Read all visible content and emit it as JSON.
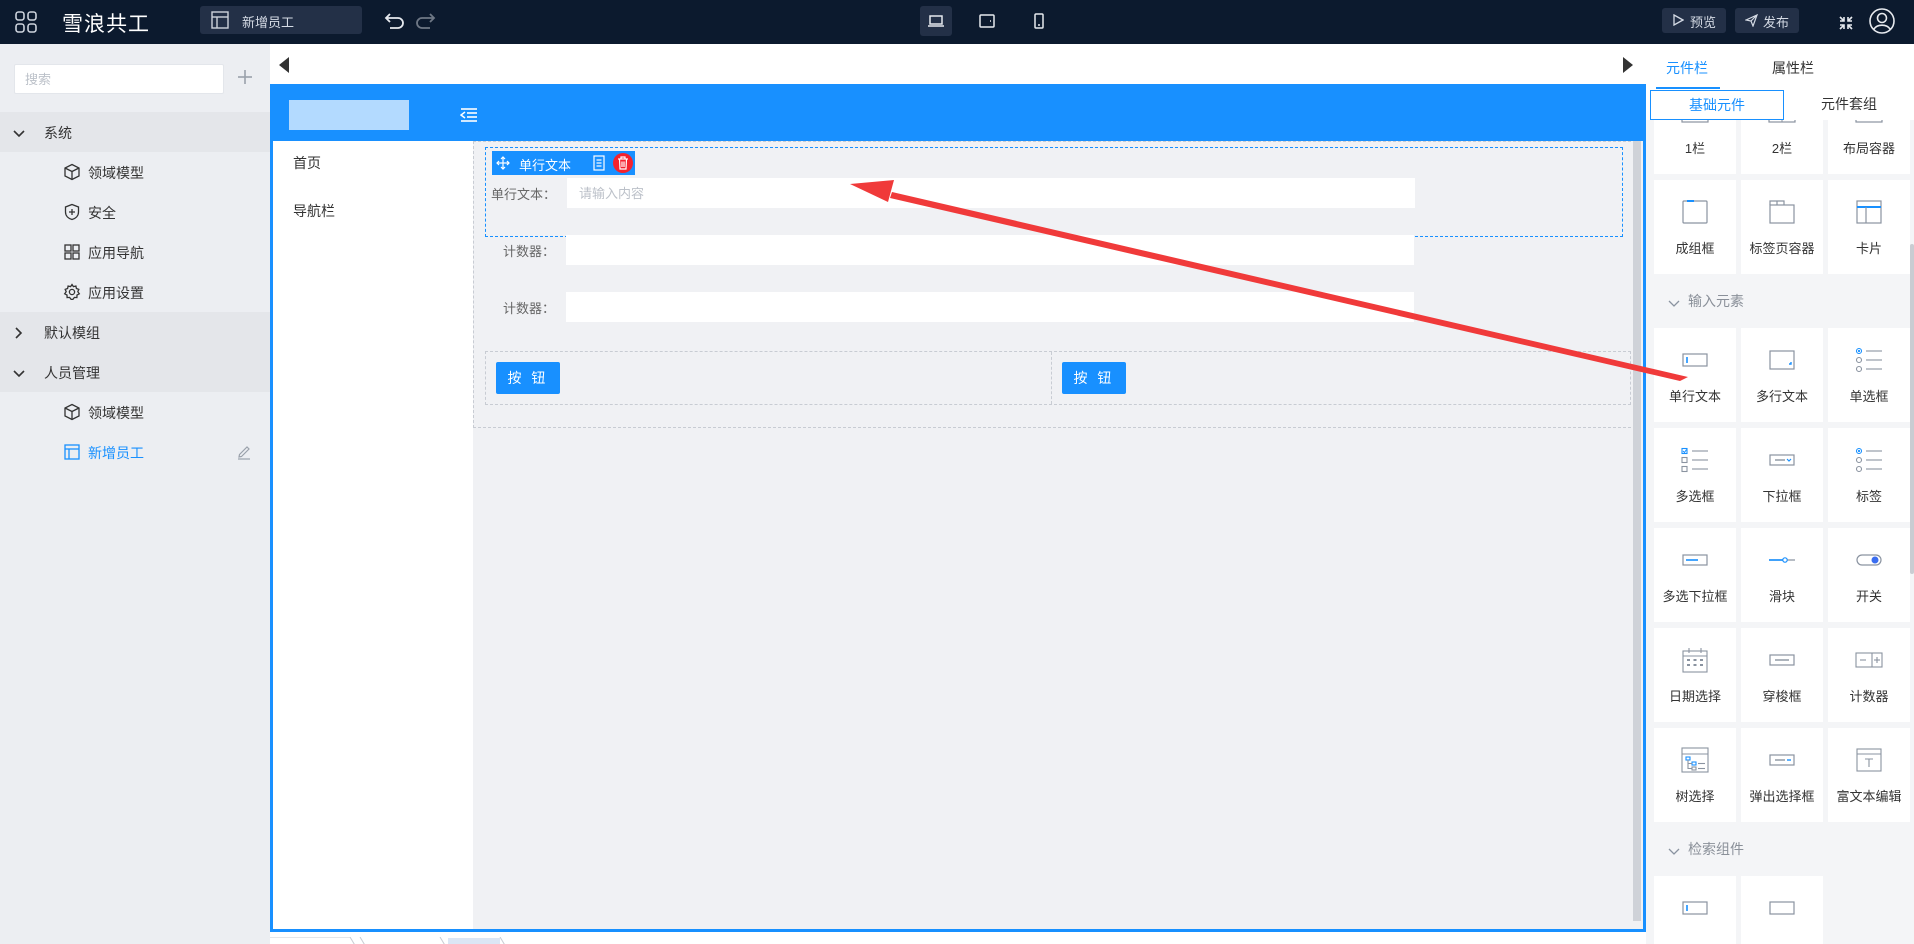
{
  "app": {
    "title": "雪浪共工"
  },
  "toolbar": {
    "current_page": "新增员工",
    "preview_label": "预览",
    "publish_label": "发布"
  },
  "sidebar": {
    "search_placeholder": "搜索",
    "groups": [
      {
        "label": "系统",
        "expanded": true,
        "items": [
          {
            "label": "领域模型",
            "icon": "cube-icon"
          },
          {
            "label": "安全",
            "icon": "shield-icon"
          },
          {
            "label": "应用导航",
            "icon": "grid-icon"
          },
          {
            "label": "应用设置",
            "icon": "gear-icon"
          }
        ]
      },
      {
        "label": "默认模组",
        "expanded": false,
        "items": []
      },
      {
        "label": "人员管理",
        "expanded": true,
        "items": [
          {
            "label": "领域模型",
            "icon": "cube-icon"
          },
          {
            "label": "新增员工",
            "icon": "layout-icon",
            "active": true
          }
        ]
      }
    ]
  },
  "canvas": {
    "nav": [
      "首页",
      "导航栏"
    ],
    "selected_component": {
      "name": "单行文本"
    },
    "form": [
      {
        "label": "单行文本：",
        "placeholder": "请输入内容"
      },
      {
        "label": "计数器：",
        "placeholder": ""
      },
      {
        "label": "计数器：",
        "placeholder": ""
      }
    ],
    "buttons": [
      "按 钮",
      "按 钮"
    ]
  },
  "right_panel": {
    "tabs": [
      "元件栏",
      "属性栏"
    ],
    "active_tab": 0,
    "subtabs": [
      "基础元件",
      "元件套组"
    ],
    "active_subtab": 0,
    "layout_components": [
      "1栏",
      "2栏",
      "布局容器",
      "成组框",
      "标签页容器",
      "卡片"
    ],
    "input_section_title": "输入元素",
    "input_components": [
      "单行文本",
      "多行文本",
      "单选框",
      "多选框",
      "下拉框",
      "标签",
      "多选下拉框",
      "滑块",
      "开关",
      "日期选择",
      "穿梭框",
      "计数器",
      "树选择",
      "弹出选择框",
      "富文本编辑"
    ],
    "search_section_title": "检索组件"
  },
  "colors": {
    "accent": "#1890ff",
    "topbar": "#0c1a2e",
    "danger": "#f5222d",
    "annotation": "#f03a3a"
  }
}
